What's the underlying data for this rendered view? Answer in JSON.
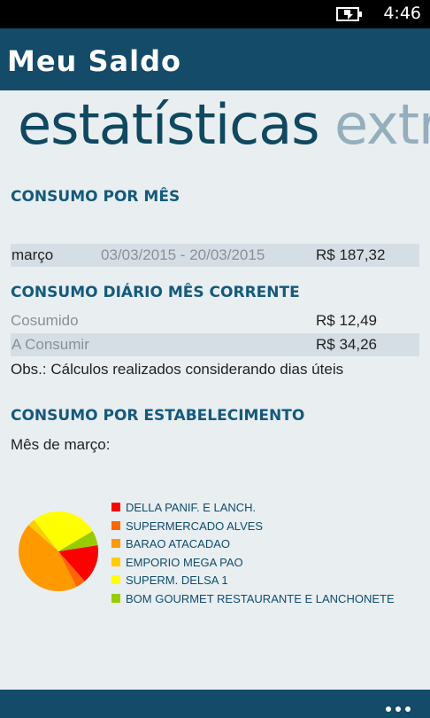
{
  "status_bar": {
    "time": "4:46",
    "battery_icon": "battery-charging-icon"
  },
  "app": {
    "title": "Meu Saldo"
  },
  "pivot": {
    "active": "estatísticas",
    "next": "extr"
  },
  "consumo_mes": {
    "title": "CONSUMO POR MÊS",
    "row": {
      "month": "março",
      "period": "03/03/2015 - 20/03/2015",
      "amount": "R$ 187,32"
    }
  },
  "consumo_diario": {
    "title": "CONSUMO DIÁRIO MÊS CORRENTE",
    "consumed_label": "Cosumido",
    "consumed_value": "R$ 12,49",
    "to_consume_label": "A Consumir",
    "to_consume_value": "R$ 34,26",
    "note": "Obs.: Cálculos realizados considerando dias úteis"
  },
  "consumo_estab": {
    "title": "CONSUMO POR ESTABELECIMENTO",
    "subtitle": "Mês de março:"
  },
  "chart_data": {
    "type": "pie",
    "title": "",
    "labels": [
      "DELLA PANIF. E LANCH.",
      "SUPERMERCADO ALVES",
      "BARAO ATACADAO",
      "EMPORIO MEGA PAO",
      "SUPERM. DELSA 1",
      "BOM GOURMET RESTAURANTE E LANCHONETE"
    ],
    "values": [
      16,
      4,
      44,
      3,
      27,
      6
    ],
    "colors": [
      "#ff0000",
      "#ff6600",
      "#ff9900",
      "#ffcc00",
      "#ffff00",
      "#99cc00"
    ],
    "legend_position": "right"
  },
  "app_bar": {
    "more_icon": "ellipsis-icon"
  }
}
